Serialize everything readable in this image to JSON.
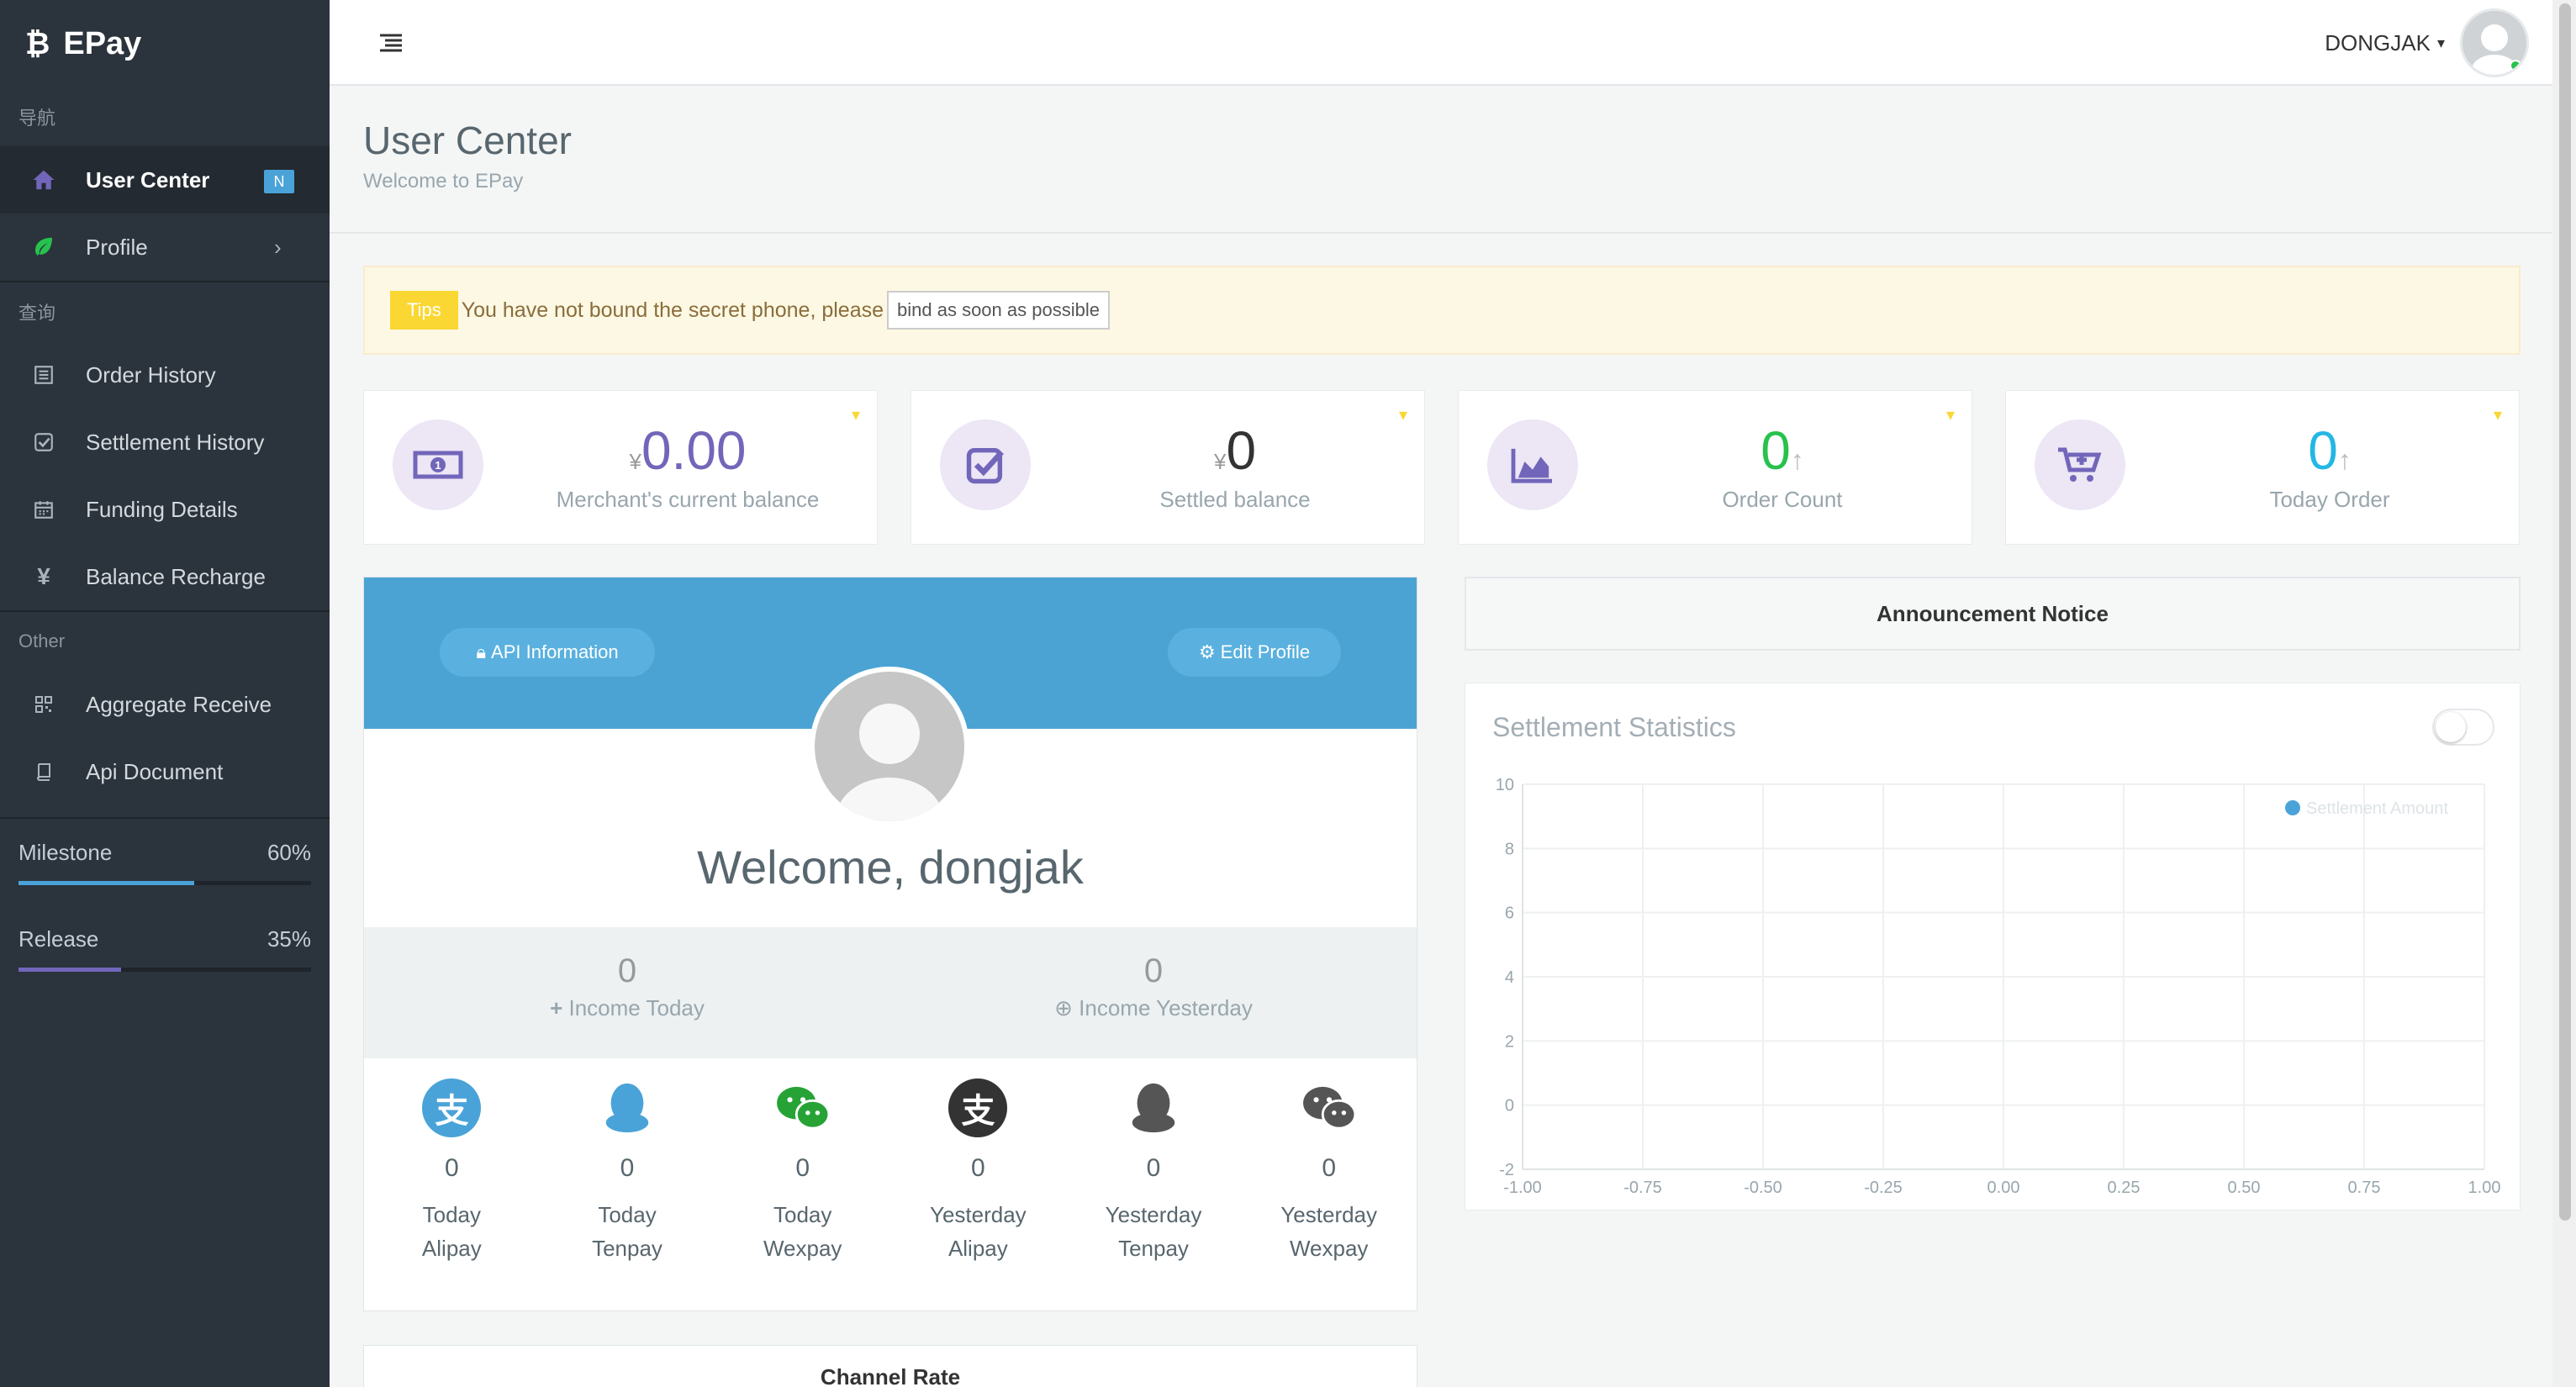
{
  "brand": {
    "name": "EPay"
  },
  "sidebar": {
    "sections": {
      "nav": "导航",
      "query": "查询",
      "other": "Other"
    },
    "items": [
      {
        "label": "User Center",
        "badge": "N"
      },
      {
        "label": "Profile"
      },
      {
        "label": "Order History"
      },
      {
        "label": "Settlement History"
      },
      {
        "label": "Funding Details"
      },
      {
        "label": "Balance Recharge"
      },
      {
        "label": "Aggregate Receive"
      },
      {
        "label": "Api Document"
      }
    ],
    "progress": [
      {
        "label": "Milestone",
        "value": "60%",
        "fraction": 0.6,
        "color": "#4aa3d8"
      },
      {
        "label": "Release",
        "value": "35%",
        "fraction": 0.35,
        "color": "#7266ba"
      }
    ]
  },
  "topbar": {
    "username": "DONGJAK"
  },
  "page": {
    "title": "User Center",
    "subtitle": "Welcome to EPay"
  },
  "alert": {
    "tag": "Tips",
    "text": "You have not bound the secret phone, please",
    "link": "bind as soon as possible"
  },
  "stats": [
    {
      "currency": "¥",
      "value": "0.00",
      "label": "Merchant's current balance",
      "icon": "money-icon"
    },
    {
      "currency": "¥",
      "value": "0",
      "label": "Settled balance",
      "icon": "check-square-icon"
    },
    {
      "value": "0",
      "label": "Order Count",
      "icon": "area-chart-icon",
      "arrow": "↑"
    },
    {
      "value": "0",
      "label": "Today Order",
      "icon": "cart-plus-icon",
      "arrow": "↑"
    }
  ],
  "profile": {
    "api_button": "API Information",
    "edit_button": "Edit Profile",
    "welcome": "Welcome,   dongjak",
    "income_today": {
      "value": "0",
      "label": "Income Today"
    },
    "income_yesterday": {
      "value": "0",
      "label": "Income Yesterday"
    },
    "payments": [
      {
        "value": "0",
        "line1": "Today",
        "line2": "Alipay",
        "icon": "alipay-icon",
        "color": "#4aa3d8"
      },
      {
        "value": "0",
        "line1": "Today",
        "line2": "Tenpay",
        "icon": "qq-icon",
        "color": "#4aa3d8"
      },
      {
        "value": "0",
        "line1": "Today",
        "line2": "Wexpay",
        "icon": "wechat-icon",
        "color": "#27a336"
      },
      {
        "value": "0",
        "line1": "Yesterday",
        "line2": "Alipay",
        "icon": "alipay-icon",
        "color": "#333333"
      },
      {
        "value": "0",
        "line1": "Yesterday",
        "line2": "Tenpay",
        "icon": "qq-icon",
        "color": "#555555"
      },
      {
        "value": "0",
        "line1": "Yesterday",
        "line2": "Wexpay",
        "icon": "wechat-icon",
        "color": "#555555"
      }
    ]
  },
  "channel": {
    "title": "Channel Rate"
  },
  "announcement": {
    "title": "Announcement Notice"
  },
  "settlement": {
    "title": "Settlement Statistics"
  },
  "chart_data": {
    "type": "line",
    "title": "Settlement Statistics",
    "series": [
      {
        "name": "Settlement Amount",
        "values": []
      }
    ],
    "xlim": [
      -1.0,
      1.0
    ],
    "ylim": [
      -2,
      10
    ],
    "xticks": [
      "-1.00",
      "-0.75",
      "-0.50",
      "-0.25",
      "0.00",
      "0.25",
      "0.50",
      "0.75",
      "1.00"
    ],
    "yticks": [
      "10",
      "8",
      "6",
      "4",
      "2",
      "0",
      "-2"
    ],
    "legend_position": "top-right",
    "grid": true,
    "legend_color": "#4aa3d8"
  }
}
